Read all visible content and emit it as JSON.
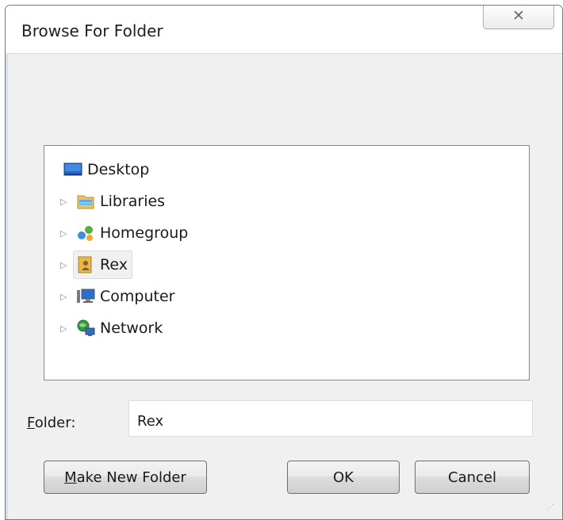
{
  "window": {
    "title": "Browse For Folder",
    "close_glyph": "✕"
  },
  "tree": {
    "items": [
      {
        "label": "Desktop",
        "icon": "desktop-icon",
        "expandable": false,
        "selected": false
      },
      {
        "label": "Libraries",
        "icon": "libraries-icon",
        "expandable": true,
        "selected": false
      },
      {
        "label": "Homegroup",
        "icon": "homegroup-icon",
        "expandable": true,
        "selected": false
      },
      {
        "label": "Rex",
        "icon": "user-folder-icon",
        "expandable": true,
        "selected": true
      },
      {
        "label": "Computer",
        "icon": "computer-icon",
        "expandable": true,
        "selected": false
      },
      {
        "label": "Network",
        "icon": "network-icon",
        "expandable": true,
        "selected": false
      }
    ],
    "expand_glyph": "▷"
  },
  "folder": {
    "label_access_key": "F",
    "label_rest": "older:",
    "value": "Rex"
  },
  "buttons": {
    "make_new_folder_access_key": "M",
    "make_new_folder_rest": "ake New Folder",
    "ok": "OK",
    "cancel": "Cancel"
  },
  "colors": {
    "accent": "#cfe2f5",
    "selection": "#f1f1f1"
  }
}
